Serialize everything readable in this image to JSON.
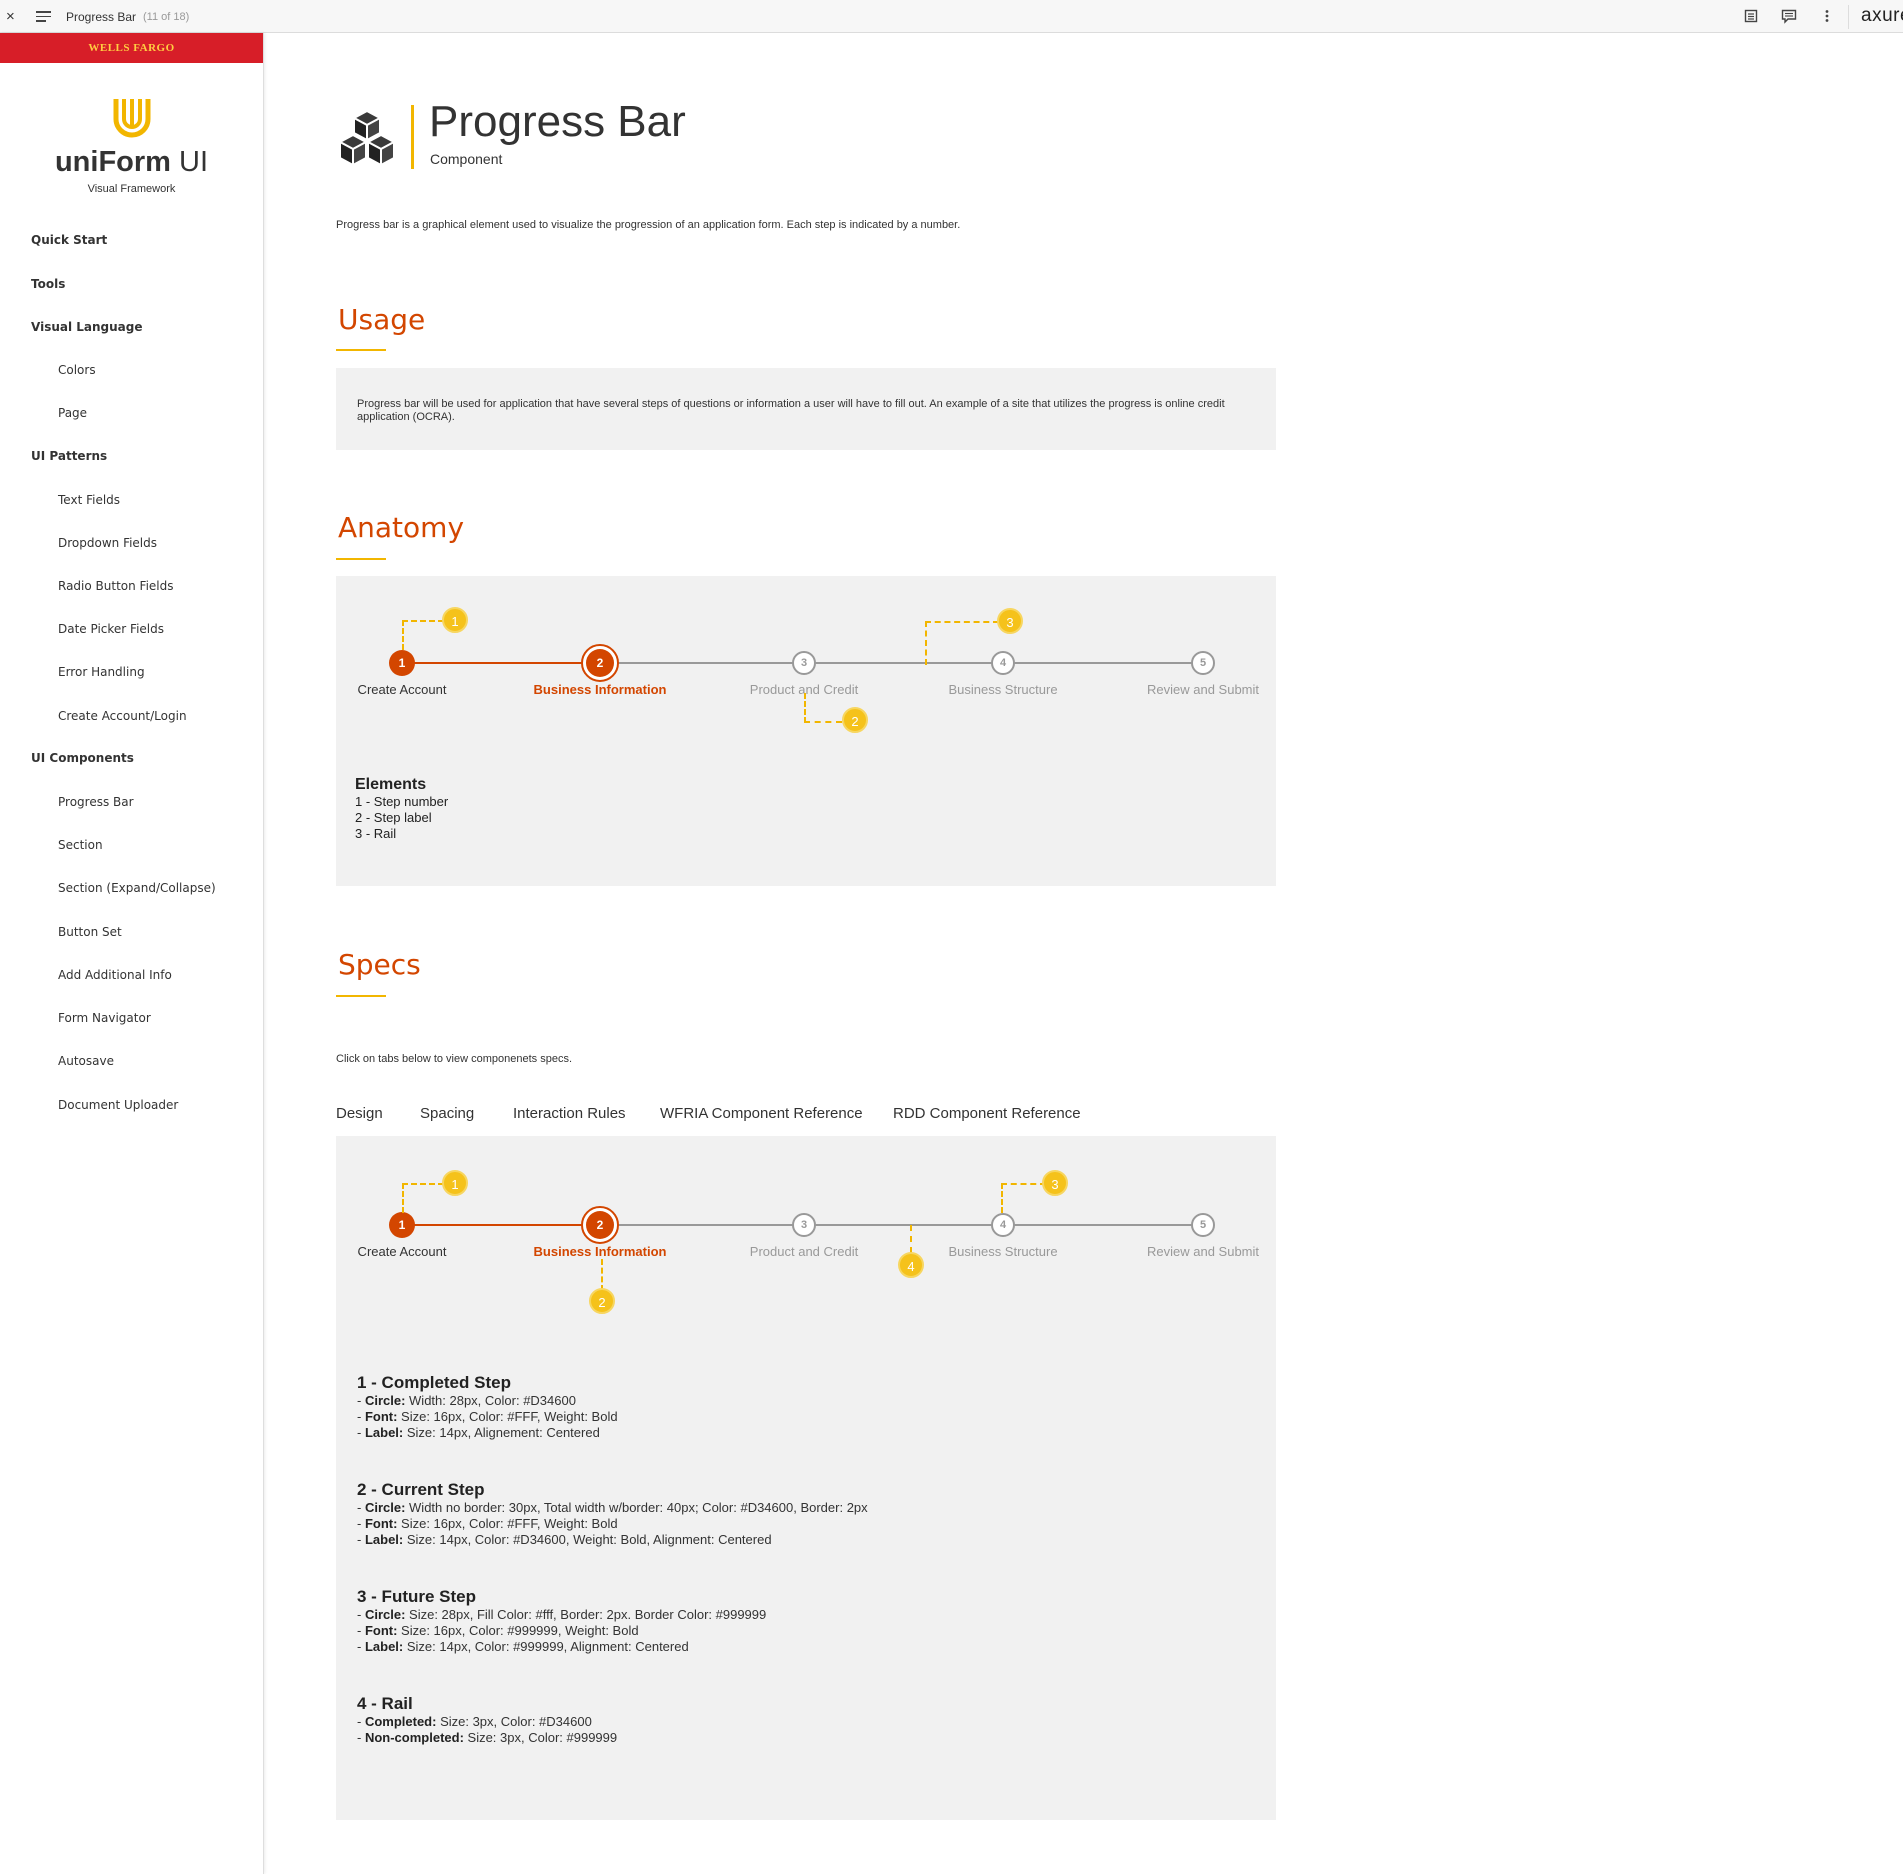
{
  "topbar": {
    "close": "×",
    "title": "Progress Bar",
    "count": "(11 of 18)",
    "brand": "axure"
  },
  "sidebar": {
    "bank": "WELLS FARGO",
    "logo_bold": "uniForm",
    "logo_light": " UI",
    "logo_sub": "Visual Framework",
    "items": [
      {
        "label": "Quick Start",
        "level": "top"
      },
      {
        "label": "Tools",
        "level": "top"
      },
      {
        "label": "Visual Language",
        "level": "top"
      },
      {
        "label": "Colors",
        "level": "sub"
      },
      {
        "label": "Page",
        "level": "sub"
      },
      {
        "label": "UI Patterns",
        "level": "top"
      },
      {
        "label": "Text Fields",
        "level": "sub"
      },
      {
        "label": "Dropdown Fields",
        "level": "sub"
      },
      {
        "label": "Radio Button Fields",
        "level": "sub"
      },
      {
        "label": "Date Picker Fields",
        "level": "sub"
      },
      {
        "label": "Error Handling",
        "level": "sub"
      },
      {
        "label": "Create Account/Login",
        "level": "sub"
      },
      {
        "label": "UI Components",
        "level": "top"
      },
      {
        "label": "Progress Bar",
        "level": "sub"
      },
      {
        "label": "Section",
        "level": "sub"
      },
      {
        "label": "Section (Expand/Collapse)",
        "level": "sub"
      },
      {
        "label": "Button Set",
        "level": "sub"
      },
      {
        "label": "Add Additional Info",
        "level": "sub"
      },
      {
        "label": "Form Navigator",
        "level": "sub"
      },
      {
        "label": "Autosave",
        "level": "sub"
      },
      {
        "label": "Document Uploader",
        "level": "sub"
      }
    ]
  },
  "header": {
    "title": "Progress Bar",
    "subtitle": "Component"
  },
  "intro": "Progress bar is a graphical element used to visualize the progression of an application form. Each step is indicated by a number.",
  "usage": {
    "title": "Usage",
    "text": "Progress bar will be used for application that have several steps of questions or information a user will have to fill out. An example of a site that utilizes the progress is online credit application (OCRA)."
  },
  "anatomy": {
    "title": "Anatomy",
    "elements_title": "Elements",
    "elements": [
      "1 - Step number",
      "2 - Step label",
      "3 - Rail"
    ],
    "callouts": [
      "1",
      "2",
      "3"
    ]
  },
  "steps": [
    {
      "num": "1",
      "label": "Create Account",
      "state": "completed"
    },
    {
      "num": "2",
      "label": "Business Information",
      "state": "current"
    },
    {
      "num": "3",
      "label": "Product and Credit",
      "state": "future"
    },
    {
      "num": "4",
      "label": "Business Structure",
      "state": "future"
    },
    {
      "num": "5",
      "label": "Review and Submit",
      "state": "future"
    }
  ],
  "specs": {
    "title": "Specs",
    "note": "Click on tabs below to view componenets specs.",
    "tabs": [
      "Design",
      "Spacing",
      "Interaction Rules",
      "WFRIA Component Reference",
      "RDD Component Reference"
    ],
    "active_tab": "Design",
    "callouts": [
      "1",
      "2",
      "3",
      "4"
    ],
    "blocks": [
      {
        "title": "1 - Completed Step",
        "lines": [
          {
            "key": "Circle:",
            "val": " Width: 28px, Color: #D34600"
          },
          {
            "key": "Font:",
            "val": " Size: 16px, Color: #FFF, Weight: Bold"
          },
          {
            "key": "Label:",
            "val": " Size: 14px, Alignement: Centered"
          }
        ]
      },
      {
        "title": "2 - Current Step",
        "lines": [
          {
            "key": "Circle:",
            "val": " Width no border: 30px, Total width w/border: 40px; Color: #D34600, Border: 2px"
          },
          {
            "key": "Font:",
            "val": " Size: 16px, Color: #FFF, Weight: Bold"
          },
          {
            "key": "Label:",
            "val": " Size: 14px, Color: #D34600, Weight: Bold, Alignment: Centered"
          }
        ]
      },
      {
        "title": "3 - Future Step",
        "lines": [
          {
            "key": "Circle:",
            "val": " Size: 28px, Fill Color: #fff, Border: 2px. Border Color: #999999"
          },
          {
            "key": "Font:",
            "val": " Size: 16px, Color: #999999, Weight: Bold"
          },
          {
            "key": "Label:",
            "val": " Size: 14px, Color: #999999, Alignment: Centered"
          }
        ]
      },
      {
        "title": "4 - Rail",
        "lines": [
          {
            "key": "Completed:",
            "val": " Size: 3px, Color: #D34600"
          },
          {
            "key": "Non-completed:",
            "val": " Size: 3px, Color: #999999"
          }
        ]
      }
    ]
  },
  "colors": {
    "accent": "#D34600",
    "future": "#999999",
    "callout": "#F5C21B",
    "rule": "#F2B600",
    "bank_red": "#D71E28",
    "bank_gold": "#FFCD41"
  }
}
